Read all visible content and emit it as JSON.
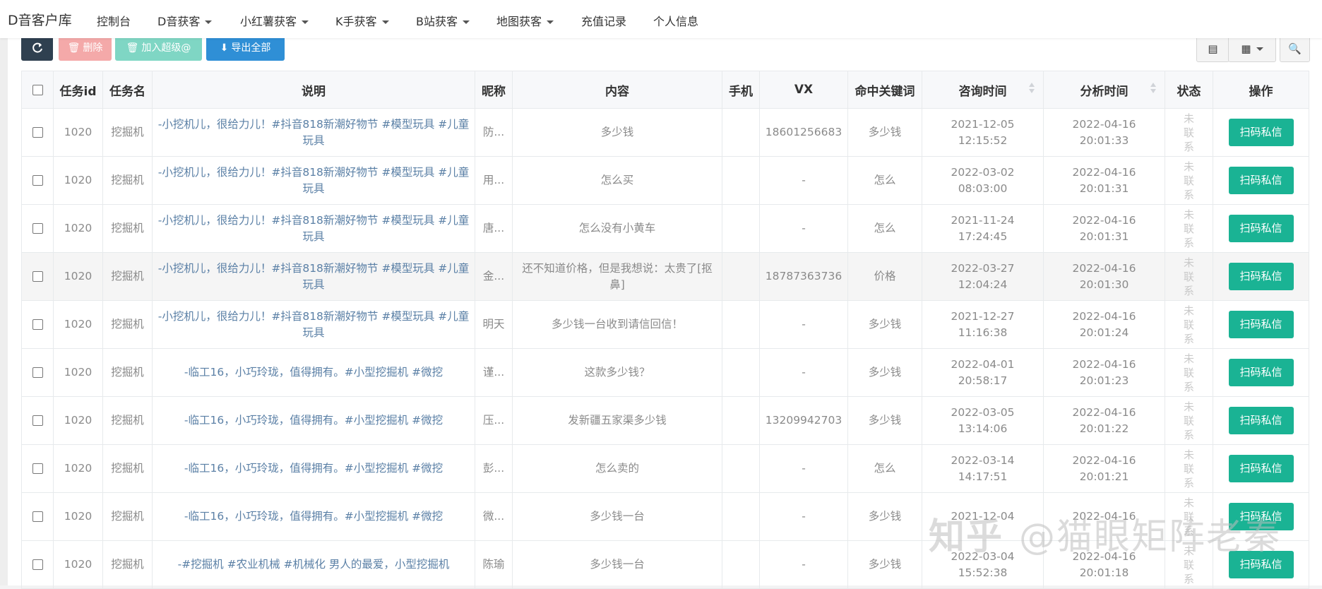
{
  "nav": {
    "brand": "D音客户库",
    "items": [
      {
        "label": "控制台",
        "dropdown": false
      },
      {
        "label": "D音获客",
        "dropdown": true
      },
      {
        "label": "小红薯获客",
        "dropdown": true
      },
      {
        "label": "K手获客",
        "dropdown": true
      },
      {
        "label": "B站获客",
        "dropdown": true
      },
      {
        "label": "地图获客",
        "dropdown": true
      },
      {
        "label": "充值记录",
        "dropdown": false
      },
      {
        "label": "个人信息",
        "dropdown": false
      }
    ]
  },
  "toolbar": {
    "refresh_icon": "refresh-icon",
    "delete_label": "删除",
    "super_label": "加入超级@",
    "export_label": "导出全部",
    "colors": {
      "refresh": "#2f4050",
      "delete": "#f4a9a9",
      "super": "#7fd6c4",
      "export": "#2f8fd6"
    }
  },
  "table": {
    "headers": [
      "任务id",
      "任务名",
      "说明",
      "昵称",
      "内容",
      "手机",
      "VX",
      "命中关键词",
      "咨询时间",
      "分析时间",
      "状态",
      "操作"
    ],
    "action_label": "扫码私信",
    "rows": [
      {
        "id": "1020",
        "task": "挖掘机",
        "desc": "-小挖机儿，很给力儿！#抖音818新潮好物节 #模型玩具 #儿童玩具",
        "nick": "防...",
        "content": "多少钱",
        "phone": "",
        "vx": "18601256683",
        "keyword": "多少钱",
        "consult_date": "2021-12-05",
        "consult_time": "12:15:52",
        "analyze_date": "2022-04-16",
        "analyze_time": "20:01:33",
        "status": "未联系"
      },
      {
        "id": "1020",
        "task": "挖掘机",
        "desc": "-小挖机儿，很给力儿！#抖音818新潮好物节 #模型玩具 #儿童玩具",
        "nick": "用...",
        "content": "怎么买",
        "phone": "",
        "vx": "-",
        "keyword": "怎么",
        "consult_date": "2022-03-02",
        "consult_time": "08:03:00",
        "analyze_date": "2022-04-16",
        "analyze_time": "20:01:31",
        "status": "未联系"
      },
      {
        "id": "1020",
        "task": "挖掘机",
        "desc": "-小挖机儿，很给力儿！#抖音818新潮好物节 #模型玩具 #儿童玩具",
        "nick": "唐...",
        "content": "怎么没有小黄车",
        "phone": "",
        "vx": "-",
        "keyword": "怎么",
        "consult_date": "2021-11-24",
        "consult_time": "17:24:45",
        "analyze_date": "2022-04-16",
        "analyze_time": "20:01:31",
        "status": "未联系"
      },
      {
        "id": "1020",
        "task": "挖掘机",
        "desc": "-小挖机儿，很给力儿！#抖音818新潮好物节 #模型玩具 #儿童玩具",
        "nick": "金...",
        "content": "还不知道价格，但是我想说：太贵了[抠鼻]",
        "phone": "",
        "vx": "18787363736",
        "keyword": "价格",
        "consult_date": "2022-03-27",
        "consult_time": "12:04:24",
        "analyze_date": "2022-04-16",
        "analyze_time": "20:01:30",
        "status": "未联系"
      },
      {
        "id": "1020",
        "task": "挖掘机",
        "desc": "-小挖机儿，很给力儿！#抖音818新潮好物节 #模型玩具 #儿童玩具",
        "nick": "明天",
        "content": "多少钱一台收到请信回信！",
        "phone": "",
        "vx": "-",
        "keyword": "多少钱",
        "consult_date": "2021-12-27",
        "consult_time": "11:16:38",
        "analyze_date": "2022-04-16",
        "analyze_time": "20:01:24",
        "status": "未联系"
      },
      {
        "id": "1020",
        "task": "挖掘机",
        "desc": "-临工16，小巧玲珑，值得拥有。#小型挖掘机 #微挖",
        "nick": "谨...",
        "content": "这款多少钱？",
        "phone": "",
        "vx": "-",
        "keyword": "多少钱",
        "consult_date": "2022-04-01",
        "consult_time": "20:58:17",
        "analyze_date": "2022-04-16",
        "analyze_time": "20:01:23",
        "status": "未联系"
      },
      {
        "id": "1020",
        "task": "挖掘机",
        "desc": "-临工16，小巧玲珑，值得拥有。#小型挖掘机 #微挖",
        "nick": "压...",
        "content": "发新疆五家渠多少钱",
        "phone": "",
        "vx": "13209942703",
        "keyword": "多少钱",
        "consult_date": "2022-03-05",
        "consult_time": "13:14:06",
        "analyze_date": "2022-04-16",
        "analyze_time": "20:01:22",
        "status": "未联系"
      },
      {
        "id": "1020",
        "task": "挖掘机",
        "desc": "-临工16，小巧玲珑，值得拥有。#小型挖掘机 #微挖",
        "nick": "彭...",
        "content": "怎么卖的",
        "phone": "",
        "vx": "-",
        "keyword": "怎么",
        "consult_date": "2022-03-14",
        "consult_time": "14:17:51",
        "analyze_date": "2022-04-16",
        "analyze_time": "20:01:21",
        "status": "未联系"
      },
      {
        "id": "1020",
        "task": "挖掘机",
        "desc": "-临工16，小巧玲珑，值得拥有。#小型挖掘机 #微挖",
        "nick": "微...",
        "content": "多少钱一台",
        "phone": "",
        "vx": "-",
        "keyword": "多少钱",
        "consult_date": "2021-12-04",
        "consult_time": "",
        "analyze_date": "2022-04-16",
        "analyze_time": "",
        "status": "未联系"
      },
      {
        "id": "1020",
        "task": "挖掘机",
        "desc": "-#挖掘机 #农业机械 #机械化 男人的最爱，小型挖掘机",
        "nick": "陈瑜",
        "content": "多少钱一台",
        "phone": "",
        "vx": "-",
        "keyword": "多少钱",
        "consult_date": "2022-03-04",
        "consult_time": "15:52:38",
        "analyze_date": "2022-04-16",
        "analyze_time": "20:01:18",
        "status": "未联系"
      }
    ]
  },
  "watermark": {
    "prefix": "知乎",
    "author": "@猫眼矩阵老秦"
  }
}
